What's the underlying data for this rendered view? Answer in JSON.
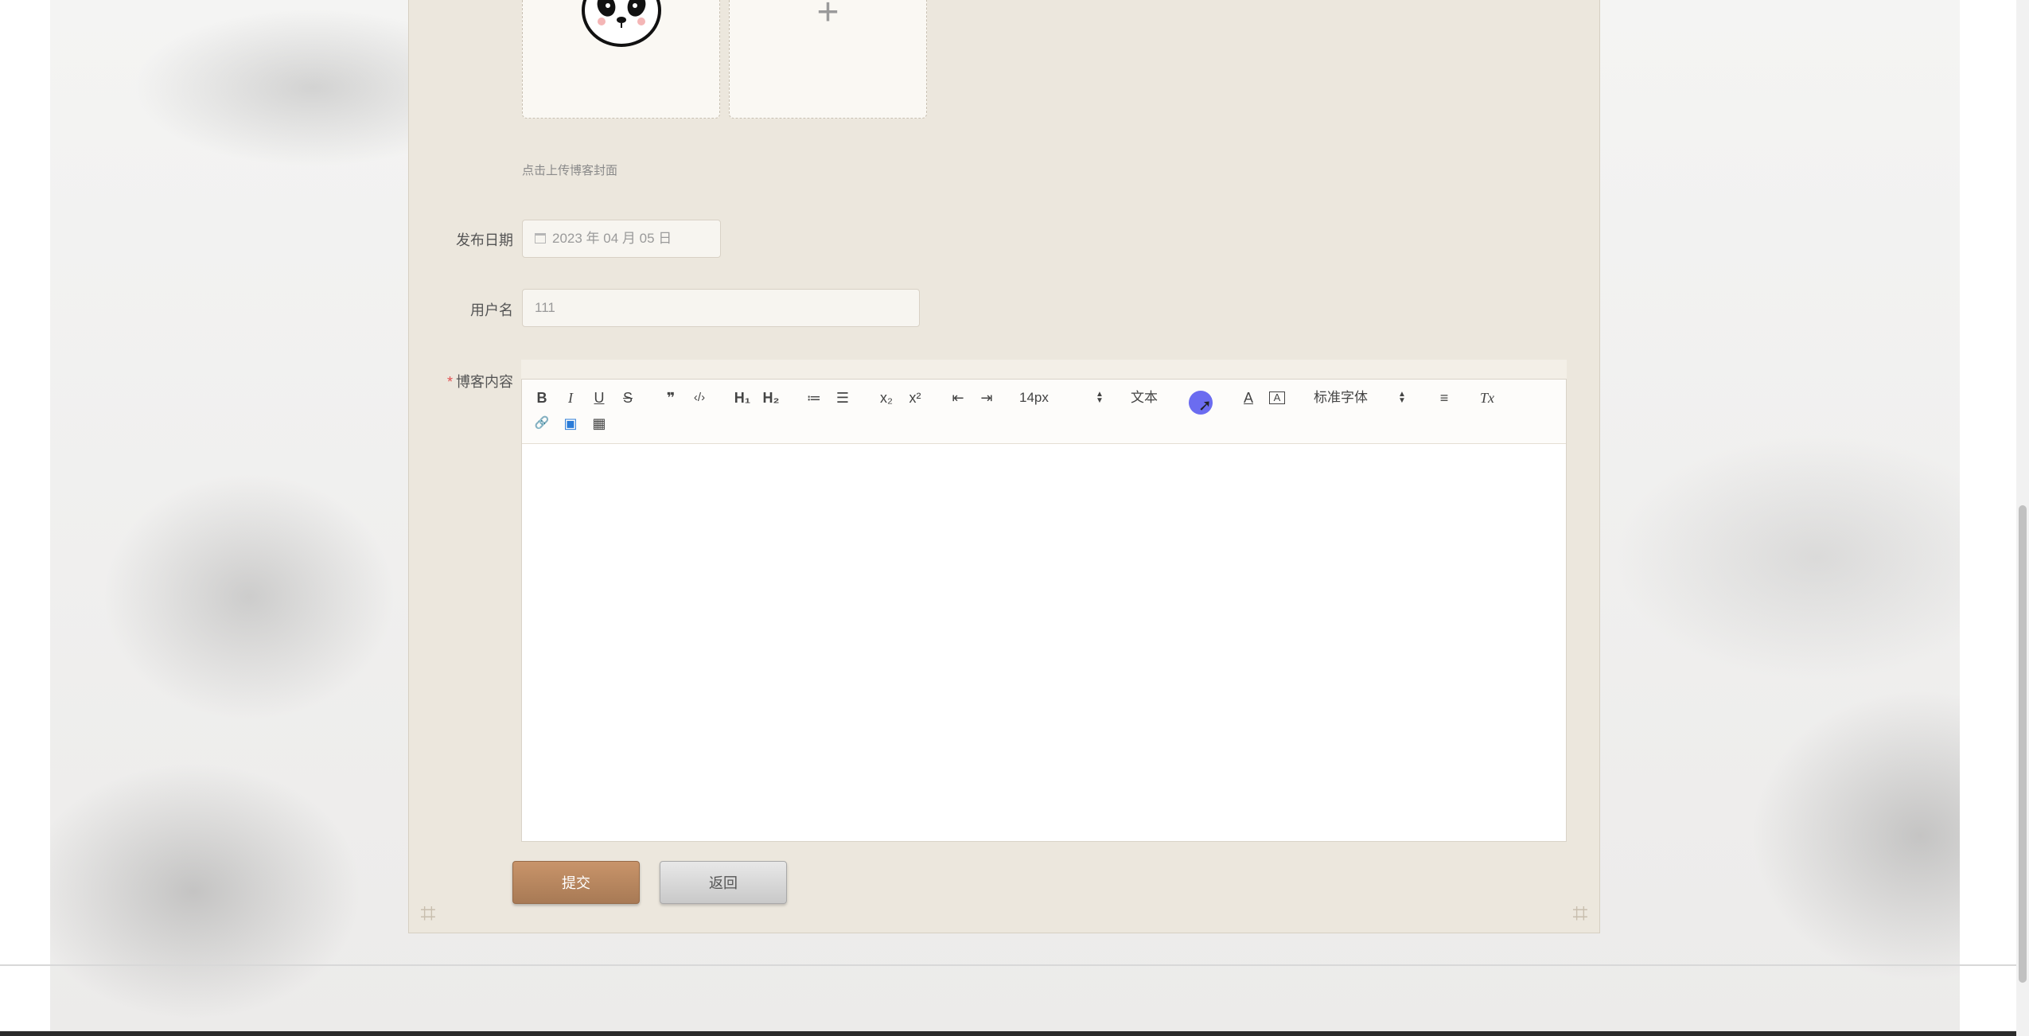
{
  "form": {
    "cover_hint": "点击上传博客封面",
    "publish_date": {
      "label": "发布日期",
      "value": "2023 年 04 月 05 日"
    },
    "username": {
      "label": "用户名",
      "value": "111"
    },
    "content": {
      "label": "博客内容",
      "required_mark": "*"
    }
  },
  "editor": {
    "toolbar": {
      "bold": "B",
      "italic": "I",
      "underline": "U",
      "strike": "S",
      "quote": "❞",
      "code": "‹/›",
      "h1": "H₁",
      "h2": "H₂",
      "ordered_list": "≔",
      "bullet_list": "☰",
      "subscript": "x₂",
      "superscript": "x²",
      "outdent": "⇤",
      "indent": "⇥",
      "font_size": "14px",
      "text_label": "文本",
      "font_color": "A",
      "bg_color": "A",
      "font_family": "标准字体",
      "align": "≡",
      "clean": "Tx",
      "link": "🔗",
      "image": "▣",
      "video": "▦"
    },
    "color_picker_value": "#6b6cf0"
  },
  "actions": {
    "submit": "提交",
    "back": "返回"
  },
  "icons": [
    "panda-avatar",
    "plus-icon",
    "calendar-icon",
    "link-icon",
    "image-icon",
    "video-icon"
  ]
}
